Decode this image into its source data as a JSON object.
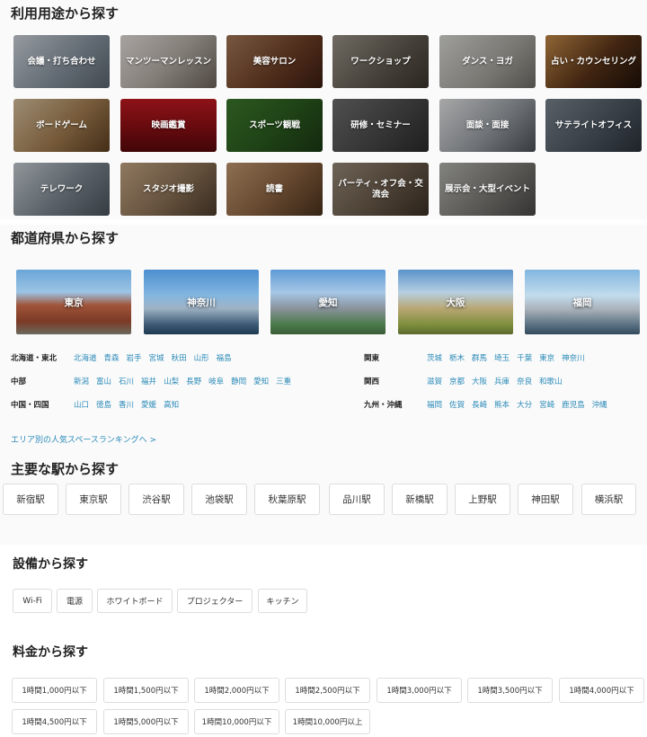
{
  "usage": {
    "title": "利用用途から探す",
    "items": [
      {
        "label": "会議・打ち合わせ"
      },
      {
        "label": "マンツーマンレッスン"
      },
      {
        "label": "美容サロン"
      },
      {
        "label": "ワークショップ"
      },
      {
        "label": "ダンス・ヨガ"
      },
      {
        "label": "占い・カウンセリング"
      },
      {
        "label": "ボードゲーム"
      },
      {
        "label": "映画鑑賞"
      },
      {
        "label": "スポーツ観戦"
      },
      {
        "label": "研修・セミナー"
      },
      {
        "label": "面談・面接"
      },
      {
        "label": "サテライトオフィス"
      },
      {
        "label": "テレワーク"
      },
      {
        "label": "スタジオ撮影"
      },
      {
        "label": "読書"
      },
      {
        "label": "パーティ・オフ会・交流会"
      },
      {
        "label": "展示会・大型イベント"
      }
    ]
  },
  "prefecture": {
    "title": "都道府県から探す",
    "featured": [
      {
        "label": "東京"
      },
      {
        "label": "神奈川"
      },
      {
        "label": "愛知"
      },
      {
        "label": "大阪"
      },
      {
        "label": "福岡"
      }
    ],
    "regions_left": [
      {
        "name": "北海道・東北",
        "prefs": [
          "北海道",
          "青森",
          "岩手",
          "宮城",
          "秋田",
          "山形",
          "福島"
        ]
      },
      {
        "name": "中部",
        "prefs": [
          "新潟",
          "富山",
          "石川",
          "福井",
          "山梨",
          "長野",
          "岐阜",
          "静岡",
          "愛知",
          "三重"
        ]
      },
      {
        "name": "中国・四国",
        "prefs": [
          "山口",
          "徳島",
          "香川",
          "愛媛",
          "高知"
        ]
      }
    ],
    "regions_right": [
      {
        "name": "関東",
        "prefs": [
          "茨城",
          "栃木",
          "群馬",
          "埼玉",
          "千葉",
          "東京",
          "神奈川"
        ]
      },
      {
        "name": "関西",
        "prefs": [
          "滋賀",
          "京都",
          "大阪",
          "兵庫",
          "奈良",
          "和歌山"
        ]
      },
      {
        "name": "九州・沖縄",
        "prefs": [
          "福岡",
          "佐賀",
          "長崎",
          "熊本",
          "大分",
          "宮崎",
          "鹿児島",
          "沖縄"
        ]
      }
    ],
    "ranking_link": "エリア別の人気スペースランキングへ >"
  },
  "stations": {
    "title": "主要な駅から探す",
    "items": [
      "新宿駅",
      "東京駅",
      "渋谷駅",
      "池袋駅",
      "秋葉原駅",
      "品川駅",
      "新橋駅",
      "上野駅",
      "神田駅",
      "横浜駅"
    ]
  },
  "facilities": {
    "title": "設備から探す",
    "items": [
      "Wi-Fi",
      "電源",
      "ホワイトボード",
      "プロジェクター",
      "キッチン"
    ]
  },
  "price": {
    "title": "料金から探す",
    "items": [
      "1時間1,000円以下",
      "1時間1,500円以下",
      "1時間2,000円以下",
      "1時間2,500円以下",
      "1時間3,000円以下",
      "1時間3,500円以下",
      "1時間4,000円以下",
      "1時間4,500円以下",
      "1時間5,000円以下",
      "1時間10,000円以下",
      "1時間10,000円以上"
    ]
  },
  "colors": {
    "link": "#2a8ab8"
  }
}
